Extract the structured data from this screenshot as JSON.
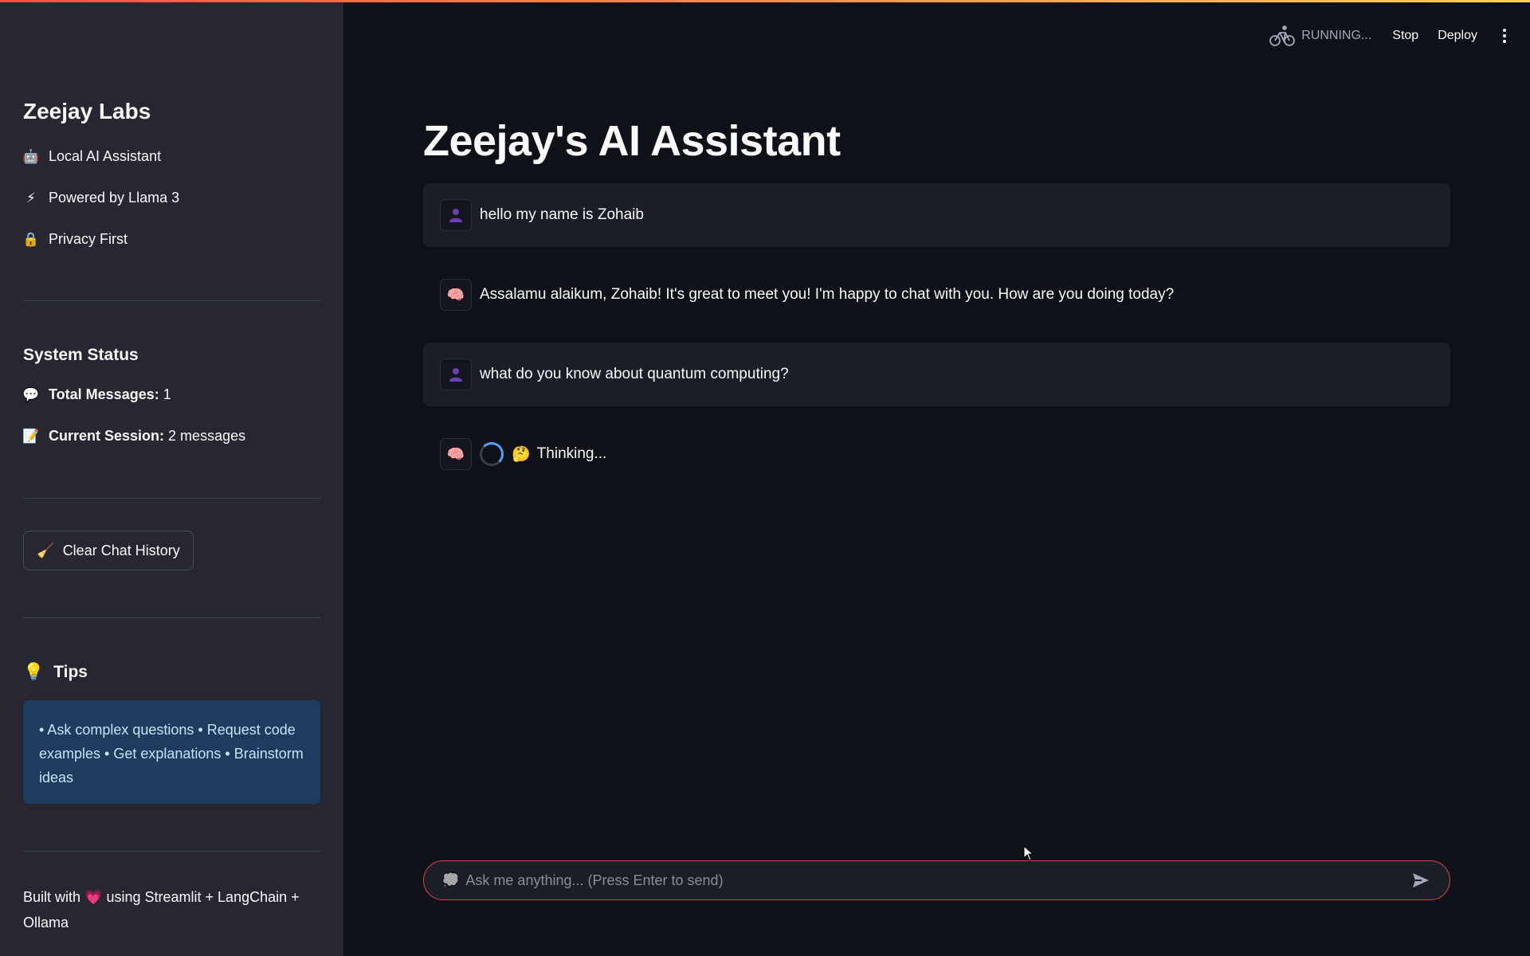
{
  "colors": {
    "background": "#0e1117",
    "sidebar": "#262730",
    "accent_red": "#e0424c",
    "tips_bg": "#1c3d5e",
    "tips_text": "#c7e2fb"
  },
  "topbar": {
    "status_label": "RUNNING...",
    "stop_label": "Stop",
    "deploy_label": "Deploy",
    "status_icon": "bicycle-icon",
    "menu_icon": "vertical-dots-icon"
  },
  "sidebar": {
    "brand": "Zeejay Labs",
    "features": [
      {
        "icon": "robot-icon",
        "glyph": "🤖",
        "label": "Local AI Assistant"
      },
      {
        "icon": "lightning-icon",
        "glyph": "⚡",
        "label": "Powered by Llama 3"
      },
      {
        "icon": "lock-icon",
        "glyph": "🔒",
        "label": "Privacy First"
      }
    ],
    "status": {
      "title": "System Status",
      "total_icon": "speech-bubble-icon",
      "total_glyph": "💬",
      "total_label": "Total Messages:",
      "total_value": "1",
      "session_icon": "memo-icon",
      "session_glyph": "📝",
      "session_label": "Current Session:",
      "session_value": "2 messages"
    },
    "clear_button": {
      "icon": "broom-icon",
      "glyph": "🧹",
      "label": "Clear Chat History"
    },
    "tips": {
      "title_icon": "lightbulb-icon",
      "title_glyph": "💡",
      "title": "Tips",
      "body": "• Ask complex questions • Request code examples • Get explanations • Brainstorm ideas"
    },
    "footer": {
      "prefix": "Built with",
      "heart_glyph": "💗",
      "suffix": "using Streamlit + LangChain + Ollama"
    }
  },
  "main": {
    "title": "Zeejay's AI Assistant",
    "messages": [
      {
        "role": "user",
        "avatar_icon": "user-avatar-icon",
        "text": "hello my name is Zohaib"
      },
      {
        "role": "assistant",
        "avatar_icon": "brain-avatar-icon",
        "glyph": "🧠",
        "text": "Assalamu alaikum, Zohaib! It's great to meet you! I'm happy to chat with you. How are you doing today?"
      },
      {
        "role": "user",
        "avatar_icon": "user-avatar-icon",
        "text": "what do you know about quantum computing?"
      },
      {
        "role": "assistant",
        "avatar_icon": "brain-avatar-icon",
        "glyph": "🧠",
        "thinking_glyph": "🤔",
        "text": "Thinking..."
      }
    ],
    "chat_input": {
      "lead_glyph": "💭",
      "placeholder": "Ask me anything... (Press Enter to send)",
      "value": "",
      "send_icon": "send-icon"
    }
  }
}
